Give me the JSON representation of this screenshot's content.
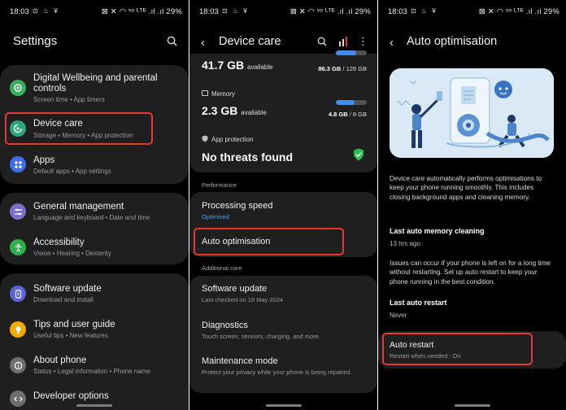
{
  "status_bar": {
    "time": "18:03",
    "left_icons": "⊡ ♨ ¥",
    "right_text": "⊠ ✕ ◠ ᵛᵒ ᴸᵀᴱ .ıl .ıl 29%"
  },
  "settings": {
    "title": "Settings",
    "groups": [
      {
        "items": [
          {
            "label": "Digital Wellbeing and parental controls",
            "sub": "Screen time  •  App timers",
            "icon": "wellbeing-icon",
            "color": "#35b15c"
          },
          {
            "label": "Device care",
            "sub": "Storage  •  Memory  •  App protection",
            "icon": "device-care-icon",
            "color": "#2aa878"
          },
          {
            "label": "Apps",
            "sub": "Default apps  •  App settings",
            "icon": "apps-icon",
            "color": "#3f6ee8"
          }
        ]
      },
      {
        "items": [
          {
            "label": "General management",
            "sub": "Language and keyboard  •  Date and time",
            "icon": "general-management-icon",
            "color": "#7a6fc9"
          },
          {
            "label": "Accessibility",
            "sub": "Vision  •  Hearing  •  Dexterity",
            "icon": "accessibility-icon",
            "color": "#2fae4c"
          }
        ]
      },
      {
        "items": [
          {
            "label": "Software update",
            "sub": "Download and install",
            "icon": "software-update-icon",
            "color": "#5a63d8"
          },
          {
            "label": "Tips and user guide",
            "sub": "Useful tips  •  New features",
            "icon": "tips-icon",
            "color": "#f2a900"
          },
          {
            "label": "About phone",
            "sub": "Status  •  Legal information  •  Phone name",
            "icon": "about-phone-icon",
            "color": "#6e6e6e"
          },
          {
            "label": "Developer options",
            "sub": "",
            "icon": "developer-options-icon",
            "color": "#6e6e6e"
          }
        ]
      }
    ]
  },
  "device_care": {
    "title": "Device care",
    "storage": {
      "value": "41.7 GB",
      "unit": "available",
      "right": "86.3 GB",
      "total": " / 128 GB",
      "used_fraction": 0.67
    },
    "memory": {
      "label": "Memory",
      "value": "2.3 GB",
      "unit": "available",
      "right": "4.8 GB",
      "total": " / 8 GB",
      "used_fraction": 0.6
    },
    "app_protection": {
      "label": "App protection",
      "value": "No threats found"
    },
    "performance_header": "Performance",
    "processing_speed": {
      "label": "Processing speed",
      "sub": "Optimised"
    },
    "auto_optimisation": "Auto optimisation",
    "additional_header": "Additional care",
    "software_update": {
      "label": "Software update",
      "sub": "Last checked on 18 May 2024"
    },
    "diagnostics": {
      "label": "Diagnostics",
      "sub": "Touch screen, sensors, charging, and more."
    },
    "maintenance": {
      "label": "Maintenance mode",
      "sub": "Protect your privacy while your phone is being repaired."
    }
  },
  "auto_opt": {
    "title": "Auto optimisation",
    "description": "Device care automatically performs optimisations to keep your phone running smoothly. This includes closing background apps and cleaning memory.",
    "last_memory_label": "Last auto memory cleaning",
    "last_memory_value": "13 hrs ago",
    "restart_desc": "Issues can occur if your phone is left on for a long time without restarting. Set up auto restart to keep your phone running in the best condition.",
    "last_restart_label": "Last auto restart",
    "last_restart_value": "Never",
    "auto_restart_label": "Auto restart",
    "auto_restart_sub": "Restart when needed : On"
  },
  "colors": {
    "accent_red": "#e53935",
    "link_blue": "#4a9ff5",
    "card": "#1f1f1f",
    "shield_green": "#27c24c"
  }
}
